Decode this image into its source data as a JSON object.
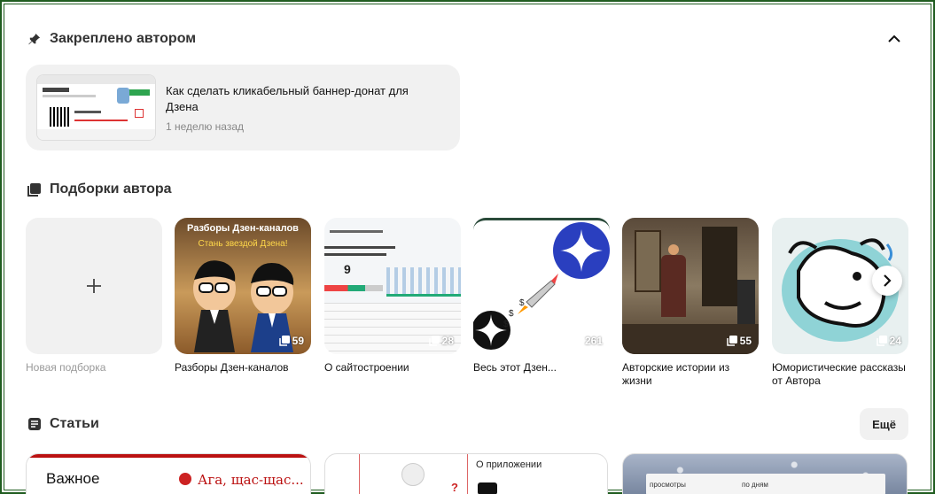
{
  "pinned": {
    "title": "Закреплено автором",
    "article_title": "Как сделать кликабельный баннер-донат для Дзена",
    "time": "1 неделю назад"
  },
  "collections": {
    "title": "Подборки автора",
    "new_label": "Новая подборка",
    "items": [
      {
        "label": "Разборы Дзен-каналов",
        "count": "59",
        "banner": "Разборы Дзен-каналов",
        "banner_sub": "Стань звездой Дзена!"
      },
      {
        "label": "О сайтостроении",
        "count": "28"
      },
      {
        "label": "Весь этот Дзен...",
        "count": "261"
      },
      {
        "label": "Авторские истории из жизни",
        "count": "55"
      },
      {
        "label": "Юмористические рассказы от Автора",
        "count": "24"
      }
    ]
  },
  "articles": {
    "title": "Статьи",
    "more_label": "Ещё",
    "cards": [
      {
        "text_a": "Важное",
        "text_b": "Ага, щас-щас..."
      },
      {
        "text_a": "О приложении"
      },
      {
        "text_a": "просмотры",
        "text_b": "по дням"
      }
    ]
  },
  "colors": {
    "frame": "#1f5c1f",
    "card_bg": "#f1f1f1",
    "accent_blue": "#2a3fbf"
  }
}
